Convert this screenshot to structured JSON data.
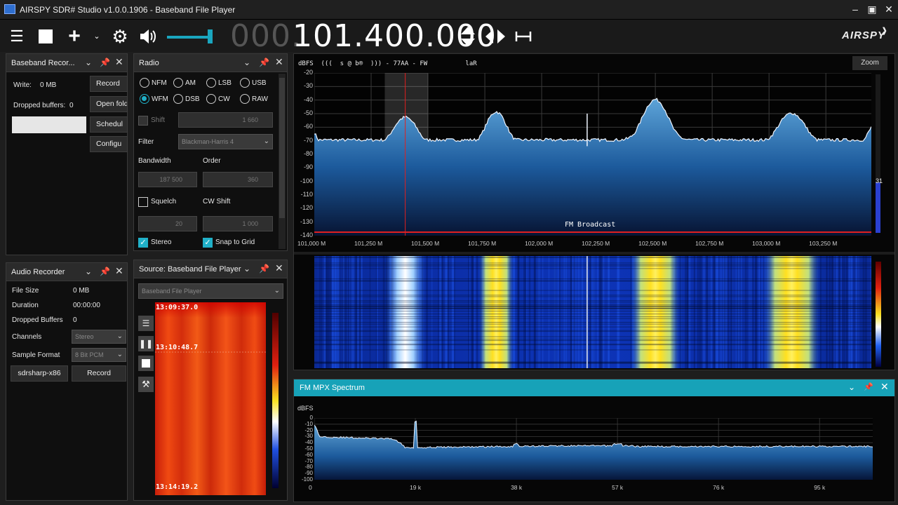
{
  "window": {
    "title": "AIRSPY SDR# Studio v1.0.0.1906 - Baseband File Player",
    "controls": [
      "minimize",
      "maximize",
      "close"
    ]
  },
  "toolbar": {
    "freq_dim": "000.",
    "freq_main": "101.400.000",
    "volume_level": 0.9,
    "logo": "AIRSPY"
  },
  "baseband_recorder": {
    "title": "Baseband Recor...",
    "write_label": "Write:",
    "write_value": "0 MB",
    "dropped_label": "Dropped buffers:",
    "dropped_value": "0",
    "buttons": [
      "Record",
      "Open fold",
      "Schedul",
      "Configu"
    ]
  },
  "radio": {
    "title": "Radio",
    "modes_row1": [
      "NFM",
      "AM",
      "LSB",
      "USB"
    ],
    "modes_row2": [
      "WFM",
      "DSB",
      "CW",
      "RAW"
    ],
    "selected_mode": "WFM",
    "shift_label": "Shift",
    "shift_value": "1 660",
    "filter_label": "Filter",
    "filter_value": "Blackman-Harris 4",
    "bandwidth_label": "Bandwidth",
    "bandwidth_value": "187 500",
    "order_label": "Order",
    "order_value": "360",
    "squelch_label": "Squelch",
    "squelch_value": "20",
    "cw_shift_label": "CW Shift",
    "cw_shift_value": "1 000",
    "stereo_label": "Stereo",
    "snap_label": "Snap to Grid"
  },
  "audio_recorder": {
    "title": "Audio Recorder",
    "rows": [
      {
        "label": "File Size",
        "value": "0 MB"
      },
      {
        "label": "Duration",
        "value": "00:00:00"
      },
      {
        "label": "Dropped Buffers",
        "value": "0"
      }
    ],
    "channels_label": "Channels",
    "channels_value": "Stereo",
    "format_label": "Sample Format",
    "format_value": "8 Bit PCM",
    "device_button": "sdrsharp-x86",
    "record_button": "Record"
  },
  "source": {
    "title": "Source: Baseband File Player",
    "combo_value": "Baseband File Player",
    "timestamps": [
      "13:09:37.0",
      "13:10:48.7",
      "13:14:19.2"
    ]
  },
  "spectrum": {
    "header": "dBFS  (((  s @ b®  ))) - 77AA - FW          laR",
    "zoom_label": "Zoom",
    "db_ticks": [
      "-20",
      "-30",
      "-40",
      "-50",
      "-60",
      "-70",
      "-80",
      "-90",
      "-100",
      "-110",
      "-120",
      "-130",
      "-140"
    ],
    "freq_ticks": [
      "101,000 M",
      "101,250 M",
      "101,500 M",
      "101,750 M",
      "102,000 M",
      "102,250 M",
      "102,500 M",
      "102,750 M",
      "103,000 M",
      "103,250 M"
    ],
    "band_label": "FM Broadcast",
    "level_readout": "31",
    "peaks_mhz": [
      101.4,
      101.8,
      102.5,
      103.1
    ],
    "peak_levels_dbfs": [
      -56,
      -52,
      -43,
      -53
    ],
    "noise_floor_dbfs": -76,
    "carrier_mhz": 102.2,
    "filter_low_mhz": 101.31,
    "filter_high_mhz": 101.5
  },
  "mpx": {
    "title": "FM MPX Spectrum",
    "db_label": "dBFS",
    "db_ticks": [
      "0",
      "-10",
      "-20",
      "-30",
      "-40",
      "-50",
      "-60",
      "-70",
      "-80",
      "-90",
      "-100"
    ],
    "freq_ticks": [
      "0",
      "19 k",
      "38 k",
      "57 k",
      "76 k",
      "95 k"
    ]
  },
  "colors": {
    "accent": "#20b0c8",
    "marker_red": "#e02020",
    "spectrum_fill_top": "#5da4d8",
    "spectrum_fill_bottom": "#071433"
  }
}
